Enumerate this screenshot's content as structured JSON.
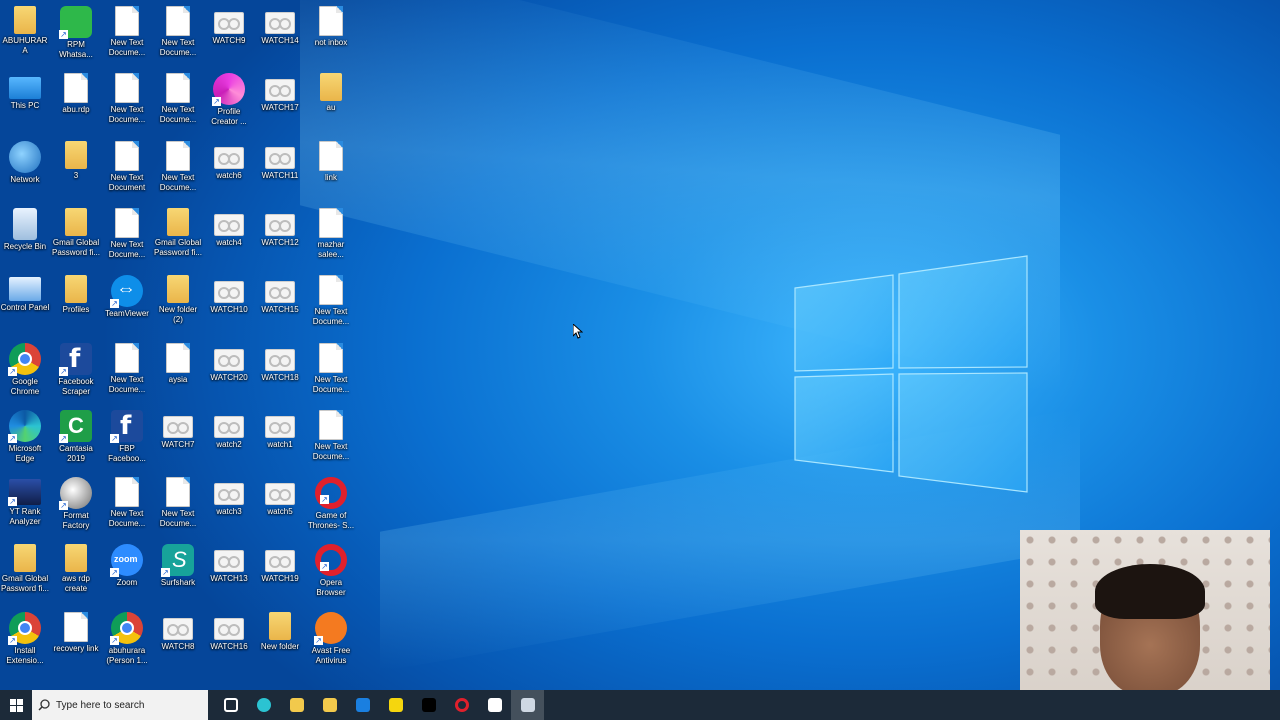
{
  "desktop": {
    "columns": [
      [
        {
          "label": "ABUHURARA",
          "icon": "user-folder-icon",
          "kind": "folder"
        },
        {
          "label": "This PC",
          "icon": "computer-icon",
          "kind": "pc"
        },
        {
          "label": "Network",
          "icon": "network-icon",
          "kind": "net"
        },
        {
          "label": "Recycle Bin",
          "icon": "recycle-bin-icon",
          "kind": "bin"
        },
        {
          "label": "Control Panel",
          "icon": "control-panel-icon",
          "kind": "panel"
        },
        {
          "label": "Google Chrome",
          "icon": "chrome-icon",
          "kind": "chrome",
          "shortcut": true
        },
        {
          "label": "Microsoft Edge",
          "icon": "edge-icon",
          "kind": "edge",
          "shortcut": true
        },
        {
          "label": "YT Rank Analyzer",
          "icon": "clapperboard-icon",
          "kind": "clap",
          "shortcut": true
        },
        {
          "label": "Gmail Global Password fi...",
          "icon": "folder-icon",
          "kind": "folder"
        },
        {
          "label": "Install Extensio...",
          "icon": "chrome-icon",
          "kind": "chrome",
          "shortcut": true
        }
      ],
      [
        {
          "label": "RPM Whatsa...",
          "icon": "rpm-whatsapp-icon",
          "kind": "rpm",
          "shortcut": true
        },
        {
          "label": "abu.rdp",
          "icon": "document-icon",
          "kind": "doc"
        },
        {
          "label": "3",
          "icon": "folder-icon",
          "kind": "folder"
        },
        {
          "label": "Gmail Global Password fi...",
          "icon": "folder-icon",
          "kind": "folder"
        },
        {
          "label": "Profiles",
          "icon": "folder-icon",
          "kind": "folder"
        },
        {
          "label": "Facebook Scraper",
          "icon": "facebook-icon",
          "kind": "fb",
          "shortcut": true
        },
        {
          "label": "Camtasia 2019",
          "icon": "camtasia-icon",
          "kind": "cam",
          "shortcut": true
        },
        {
          "label": "Format Factory",
          "icon": "format-factory-icon",
          "kind": "ff",
          "shortcut": true
        },
        {
          "label": "aws rdp create",
          "icon": "folder-icon",
          "kind": "folder"
        },
        {
          "label": "recovery link",
          "icon": "document-icon",
          "kind": "doc"
        }
      ],
      [
        {
          "label": "New Text Docume...",
          "icon": "document-icon",
          "kind": "doc"
        },
        {
          "label": "New Text Docume...",
          "icon": "document-icon",
          "kind": "doc"
        },
        {
          "label": "New Text Document",
          "icon": "document-icon",
          "kind": "doc"
        },
        {
          "label": "New Text Docume...",
          "icon": "document-icon",
          "kind": "doc"
        },
        {
          "label": "TeamViewer",
          "icon": "teamviewer-icon",
          "kind": "tv",
          "shortcut": true
        },
        {
          "label": "New Text Docume...",
          "icon": "document-icon",
          "kind": "doc"
        },
        {
          "label": "FBP Faceboo...",
          "icon": "facebook-icon",
          "kind": "fb",
          "shortcut": true
        },
        {
          "label": "New Text Docume...",
          "icon": "document-icon",
          "kind": "doc"
        },
        {
          "label": "Zoom",
          "icon": "zoom-icon",
          "kind": "zoom",
          "shortcut": true
        },
        {
          "label": "abuhurara (Person 1...",
          "icon": "chrome-icon",
          "kind": "chrome",
          "shortcut": true
        }
      ],
      [
        {
          "label": "New Text Docume...",
          "icon": "document-icon",
          "kind": "doc"
        },
        {
          "label": "New Text Docume...",
          "icon": "document-icon",
          "kind": "doc"
        },
        {
          "label": "New Text Docume...",
          "icon": "document-icon",
          "kind": "doc"
        },
        {
          "label": "Gmail Global Password fi...",
          "icon": "folder-icon",
          "kind": "folder"
        },
        {
          "label": "New folder (2)",
          "icon": "folder-icon",
          "kind": "folder"
        },
        {
          "label": "aysia",
          "icon": "document-icon",
          "kind": "doc"
        },
        {
          "label": "WATCH7",
          "icon": "watch-file-icon",
          "kind": "watch"
        },
        {
          "label": "New Text Docume...",
          "icon": "document-icon",
          "kind": "doc"
        },
        {
          "label": "Surfshark",
          "icon": "surfshark-icon",
          "kind": "surf",
          "shortcut": true
        },
        {
          "label": "WATCH8",
          "icon": "watch-file-icon",
          "kind": "watch"
        }
      ],
      [
        {
          "label": "WATCH9",
          "icon": "watch-file-icon",
          "kind": "watch"
        },
        {
          "label": "Profile Creator ...",
          "icon": "profile-creator-icon",
          "kind": "profile",
          "shortcut": true
        },
        {
          "label": "watch6",
          "icon": "watch-file-icon",
          "kind": "watch"
        },
        {
          "label": "watch4",
          "icon": "watch-file-icon",
          "kind": "watch"
        },
        {
          "label": "WATCH10",
          "icon": "watch-file-icon",
          "kind": "watch"
        },
        {
          "label": "WATCH20",
          "icon": "watch-file-icon",
          "kind": "watch"
        },
        {
          "label": "watch2",
          "icon": "watch-file-icon",
          "kind": "watch"
        },
        {
          "label": "watch3",
          "icon": "watch-file-icon",
          "kind": "watch"
        },
        {
          "label": "WATCH13",
          "icon": "watch-file-icon",
          "kind": "watch"
        },
        {
          "label": "WATCH16",
          "icon": "watch-file-icon",
          "kind": "watch"
        }
      ],
      [
        {
          "label": "WATCH14",
          "icon": "watch-file-icon",
          "kind": "watch"
        },
        {
          "label": "WATCH17",
          "icon": "watch-file-icon",
          "kind": "watch"
        },
        {
          "label": "WATCH11",
          "icon": "watch-file-icon",
          "kind": "watch"
        },
        {
          "label": "WATCH12",
          "icon": "watch-file-icon",
          "kind": "watch"
        },
        {
          "label": "WATCH15",
          "icon": "watch-file-icon",
          "kind": "watch"
        },
        {
          "label": "WATCH18",
          "icon": "watch-file-icon",
          "kind": "watch"
        },
        {
          "label": "watch1",
          "icon": "watch-file-icon",
          "kind": "watch"
        },
        {
          "label": "watch5",
          "icon": "watch-file-icon",
          "kind": "watch"
        },
        {
          "label": "WATCH19",
          "icon": "watch-file-icon",
          "kind": "watch"
        },
        {
          "label": "New folder",
          "icon": "folder-icon",
          "kind": "folder"
        }
      ],
      [
        {
          "label": "not inbox",
          "icon": "document-icon",
          "kind": "doc"
        },
        {
          "label": "au",
          "icon": "folder-icon",
          "kind": "folder"
        },
        {
          "label": "link",
          "icon": "document-icon",
          "kind": "doc"
        },
        {
          "label": "mazhar salee...",
          "icon": "document-icon",
          "kind": "doc"
        },
        {
          "label": "New Text Docume...",
          "icon": "document-icon",
          "kind": "doc"
        },
        {
          "label": "New Text Docume...",
          "icon": "document-icon",
          "kind": "doc"
        },
        {
          "label": "New Text Docume...",
          "icon": "document-icon",
          "kind": "doc"
        },
        {
          "label": "Game of Thrones- S...",
          "icon": "opera-icon",
          "kind": "opera",
          "shortcut": true
        },
        {
          "label": "Opera Browser",
          "icon": "opera-icon",
          "kind": "opera",
          "shortcut": true
        },
        {
          "label": "Avast Free Antivirus",
          "icon": "avast-icon",
          "kind": "avast",
          "shortcut": true
        }
      ]
    ]
  },
  "taskbar": {
    "search_placeholder": "Type here to search",
    "apps": [
      {
        "icon": "task-view-icon",
        "color": "#ffffff"
      },
      {
        "icon": "edge-icon",
        "color": "#2bc3d2"
      },
      {
        "icon": "file-explorer-icon",
        "color": "#f2c94c"
      },
      {
        "icon": "microsoft-store-icon",
        "color": "#f2c94c"
      },
      {
        "icon": "mail-icon",
        "color": "#1a7fe0"
      },
      {
        "icon": "sticky-notes-icon",
        "color": "#f5d60e"
      },
      {
        "icon": "tiktok-icon",
        "color": "#000000"
      },
      {
        "icon": "opera-icon",
        "color": "#e0202c"
      },
      {
        "icon": "cloud-app-icon",
        "color": "#ffffff"
      },
      {
        "icon": "recorder-app-icon",
        "color": "#cfd8e3",
        "active": true
      }
    ]
  },
  "colors": {
    "desktop_bg": "#0a6fd0",
    "taskbar_bg": "#1c2a39",
    "accent": "#3fb8ff"
  }
}
